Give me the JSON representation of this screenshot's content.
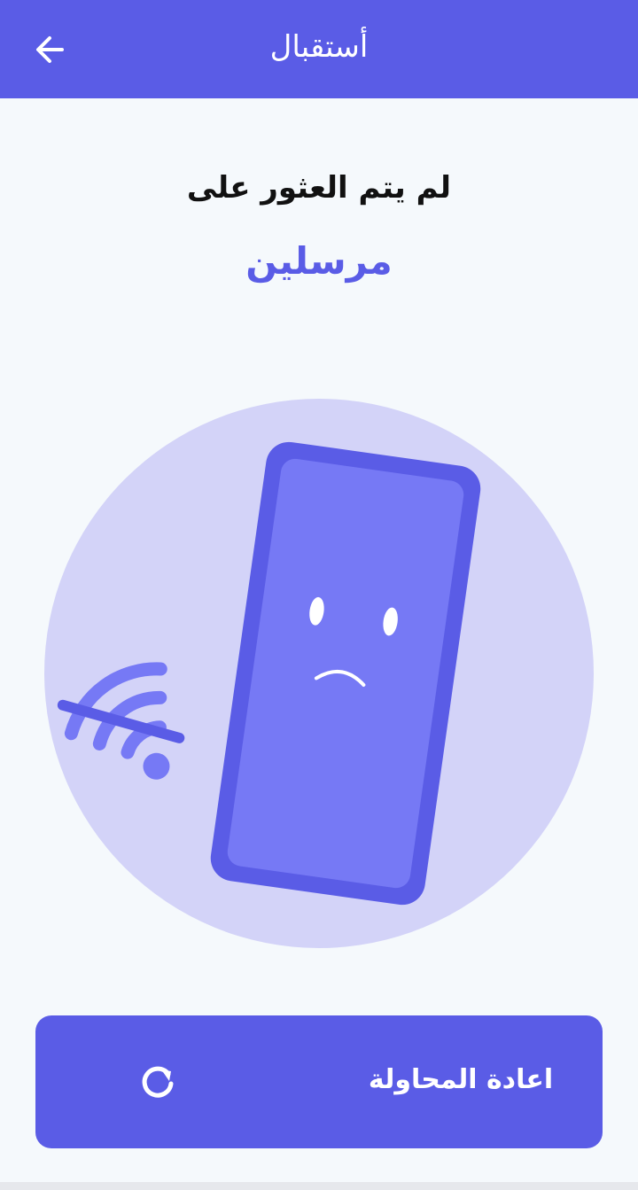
{
  "app_bar": {
    "title": "أستقبال",
    "back_icon": "arrow-left-icon",
    "background_color": "#5a5ce6"
  },
  "message": {
    "heading": "لم يتم العثور على",
    "highlight": "مرسلين"
  },
  "illustration": {
    "description_icon": "sad-phone-no-wifi-icon",
    "circle_color": "#d3d3f8",
    "phone_color": "#5a5ce6",
    "screen_color": "#7679f5"
  },
  "retry_button": {
    "label": "اعادة المحاولة",
    "icon": "refresh-icon"
  }
}
